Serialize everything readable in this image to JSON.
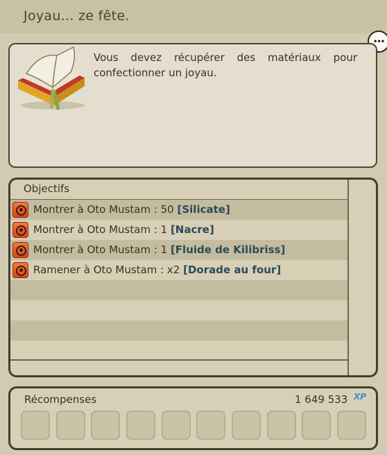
{
  "title": "Joyau... ze fête.",
  "description": "Vous devez récupérer des matériaux pour confectionner un joyau.",
  "objectives": {
    "header": "Objectifs",
    "items": [
      {
        "prefix": "Montrer à Oto Mustam : 50 ",
        "item": "[Silicate]"
      },
      {
        "prefix": "Montrer à Oto Mustam : 1 ",
        "item": "[Nacre]"
      },
      {
        "prefix": "Montrer à Oto Mustam : 1 ",
        "item": "[Fluide de Kilibriss]"
      },
      {
        "prefix": "Ramener à Oto Mustam : x2 ",
        "item": "[Dorade au four]"
      }
    ]
  },
  "rewards": {
    "label": "Récompenses",
    "xp_value": "1 649 533",
    "xp_icon_text": "XP",
    "slot_count": 10
  },
  "colors": {
    "item_link": "#2b4a59",
    "quest_icon": "#e8602a",
    "xp_icon": "#3d8fcf"
  }
}
